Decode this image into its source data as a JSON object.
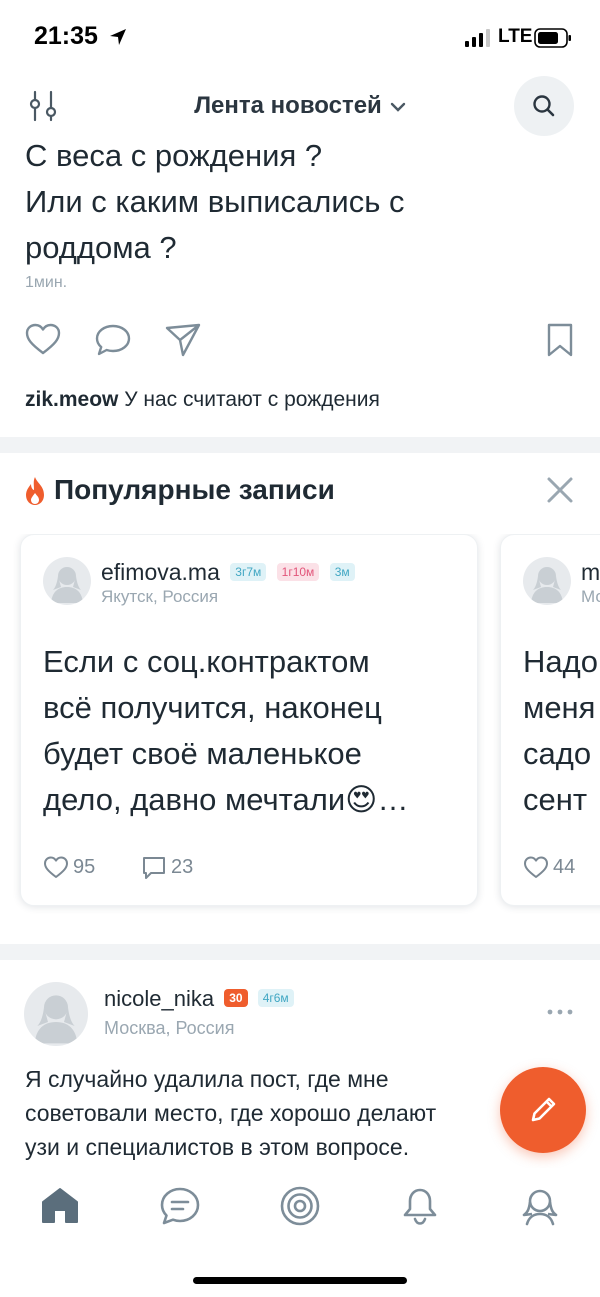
{
  "status_bar": {
    "time": "21:35",
    "network": "LTE"
  },
  "header": {
    "title": "Лента новостей"
  },
  "top_post": {
    "text_lines": [
      "С веса с рождения ?",
      "Или с каким выписались с",
      "роддома ?"
    ],
    "time": "1мин.",
    "comment": {
      "user": "zik.meow",
      "text": "У нас считают с рождения"
    }
  },
  "popular": {
    "title": "Популярные записи",
    "cards": [
      {
        "user": "efimova.ma",
        "badges": [
          "3г7м",
          "1г10м",
          "3м"
        ],
        "location": "Якутск, Россия",
        "text_lines": [
          "Если с соц.контрактом",
          "всё получится, наконец",
          "будет своё маленькое",
          "дело, давно мечтали😍…"
        ],
        "likes": "95",
        "comments": "23"
      },
      {
        "user": "m",
        "location": "Мо",
        "text_lines": [
          "Надо",
          "меня",
          "садо",
          "сент"
        ],
        "likes": "44"
      }
    ]
  },
  "post2": {
    "user": "nicole_nika",
    "badges": [
      "30",
      "4г6м"
    ],
    "location": "Москва, Россия",
    "text_lines": [
      "Я случайно удалила пост, где мне",
      "советовали место, где хорошо делают",
      "узи и специалистов в этом вопросе."
    ]
  },
  "colors": {
    "accent": "#ef5d2d",
    "icon": "#7d8d99",
    "tab_active": "#5b6e7c"
  }
}
